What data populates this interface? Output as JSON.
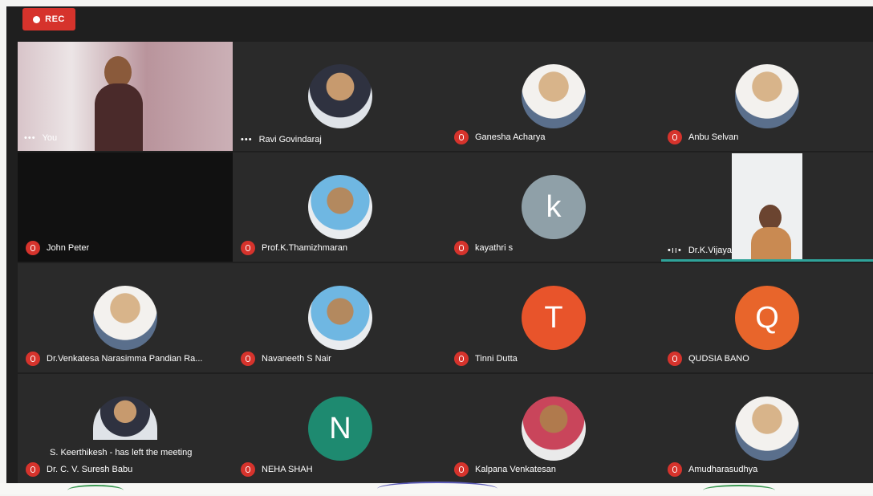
{
  "rec_label": "REC",
  "you": {
    "label": "You"
  },
  "participants": [
    {
      "name": "Ravi Govindaraj",
      "status": "dots"
    },
    {
      "name": "Ganesha Acharya",
      "status": "muted"
    },
    {
      "name": "Anbu Selvan",
      "status": "muted"
    },
    {
      "name": "John Peter",
      "status": "muted"
    },
    {
      "name": "Prof.K.Thamizhmaran",
      "status": "muted"
    },
    {
      "name": "kayathri s",
      "status": "muted",
      "initial": "k",
      "avatar_color": "#8fa0a8"
    },
    {
      "name": "Dr.K.Vijaya Elangovan",
      "status": "dots"
    },
    {
      "name": "Dr.Venkatesa Narasimma Pandian Ra...",
      "status": "muted"
    },
    {
      "name": "Navaneeth S Nair",
      "status": "muted"
    },
    {
      "name": "Tinni Dutta",
      "status": "muted",
      "initial": "T",
      "avatar_color": "#e8542b"
    },
    {
      "name": "QUDSIA BANO",
      "status": "muted",
      "initial": "Q",
      "avatar_color": "#e8652b"
    },
    {
      "name": "Dr. C. V. Suresh Babu",
      "status": "muted"
    },
    {
      "name": "NEHA SHAH",
      "status": "muted",
      "initial": "N",
      "avatar_color": "#1e8a70"
    },
    {
      "name": "Kalpana Venkatesan",
      "status": "muted"
    },
    {
      "name": "Amudharasudhya",
      "status": "muted"
    }
  ],
  "toast": "S. Keerthikesh - has left the meeting"
}
